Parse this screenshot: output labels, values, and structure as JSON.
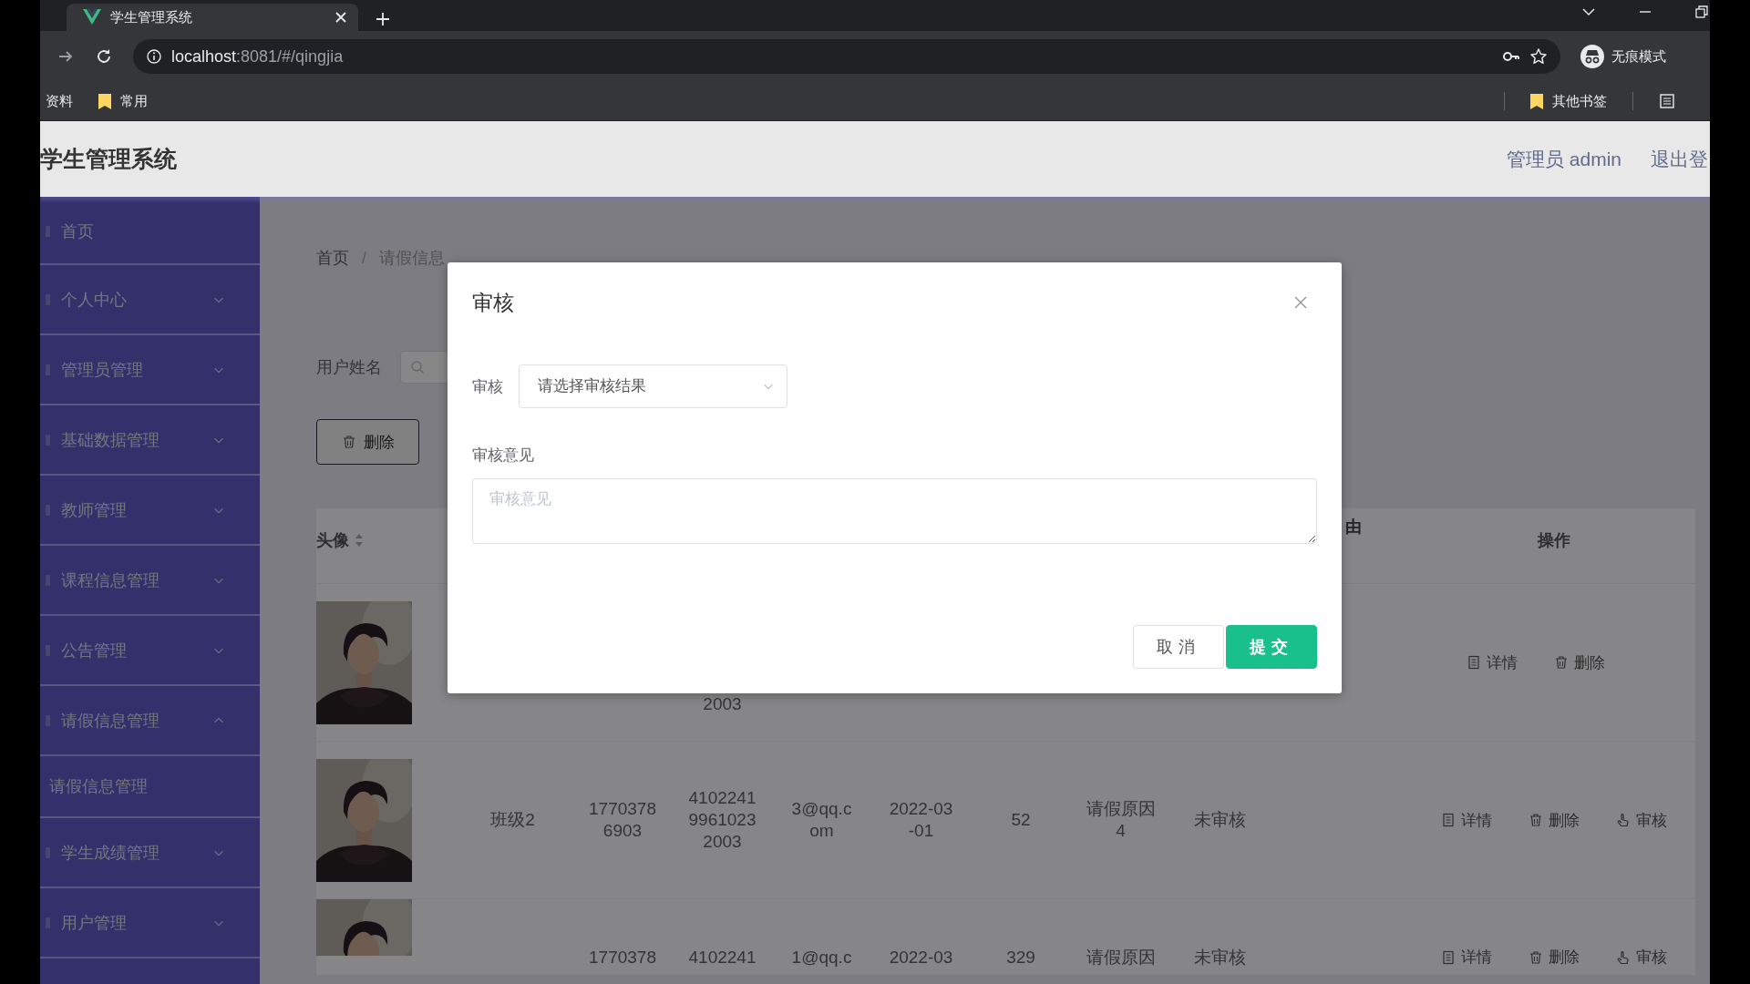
{
  "browser": {
    "tab_title": "学生管理系统",
    "url_host": "localhost",
    "url_path": ":8081/#/qingjia",
    "profile_label": "无痕模式",
    "bookmarks": [
      {
        "kind": "link",
        "label": "资料"
      },
      {
        "kind": "folder",
        "label": "常用"
      }
    ],
    "other_bookmarks": "其他书签"
  },
  "app": {
    "title": "学生管理系统",
    "user": "管理员 admin",
    "logout": "退出登"
  },
  "sidebar": {
    "items": [
      {
        "kind": "link",
        "label": "首页"
      },
      {
        "kind": "menu",
        "label": "个人中心",
        "expanded": false
      },
      {
        "kind": "menu",
        "label": "管理员管理",
        "expanded": false
      },
      {
        "kind": "menu",
        "label": "基础数据管理",
        "expanded": false
      },
      {
        "kind": "menu",
        "label": "教师管理",
        "expanded": false
      },
      {
        "kind": "menu",
        "label": "课程信息管理",
        "expanded": false
      },
      {
        "kind": "menu",
        "label": "公告管理",
        "expanded": false
      },
      {
        "kind": "menu",
        "label": "请假信息管理",
        "expanded": true,
        "children": [
          {
            "label": "请假信息管理"
          }
        ]
      },
      {
        "kind": "menu",
        "label": "学生成绩管理",
        "expanded": false
      },
      {
        "kind": "menu",
        "label": "用户管理",
        "expanded": false
      }
    ]
  },
  "breadcrumb": {
    "items": [
      "首页",
      "请假信息"
    ],
    "separator": "/"
  },
  "search": {
    "label": "用户姓名"
  },
  "toolbar": {
    "delete_button": "删除"
  },
  "table": {
    "columns": [
      {
        "label": "头像",
        "sortable": true
      },
      {
        "label": "由",
        "sortable": false
      },
      {
        "label": "操作",
        "sortable": false
      }
    ],
    "rows": [
      {
        "avatar": {
          "kind": "picture"
        },
        "column_4": "2003",
        "actions": [
          {
            "kind": "details",
            "label": "详情"
          },
          {
            "kind": "delete",
            "label": "删除"
          }
        ]
      },
      {
        "avatar": {
          "kind": "picture"
        },
        "column_2": "班级2",
        "column_3": "17703786903",
        "column_4": "410224199610232003",
        "column_5": "3@qq.com",
        "column_6": "2022-03-01",
        "column_7": "52",
        "column_8": "请假原因4",
        "column_9": "未审核",
        "actions": [
          {
            "kind": "details",
            "label": "详情"
          },
          {
            "kind": "delete",
            "label": "删除"
          },
          {
            "kind": "audit",
            "label": "审核"
          }
        ]
      },
      {
        "avatar": {
          "kind": "picture"
        },
        "column_3": "1770378",
        "column_4": "4102241",
        "column_5": "1@qq.c",
        "column_6": "2022-03",
        "column_7": "329",
        "column_8": "请假原因",
        "column_9": "未审核",
        "actions": [
          {
            "kind": "details",
            "label": "详情"
          },
          {
            "kind": "delete",
            "label": "删除"
          },
          {
            "kind": "audit",
            "label": "审核"
          }
        ]
      }
    ]
  },
  "dialog": {
    "title": "审核",
    "fields": [
      {
        "kind": "select",
        "label": "审核",
        "placeholder": "请选择审核结果"
      },
      {
        "kind": "textarea",
        "label": "审核意见",
        "placeholder": "审核意见"
      }
    ],
    "buttons": [
      {
        "kind": "cancel",
        "label": "取消"
      },
      {
        "kind": "primary",
        "label": "提交"
      }
    ]
  }
}
